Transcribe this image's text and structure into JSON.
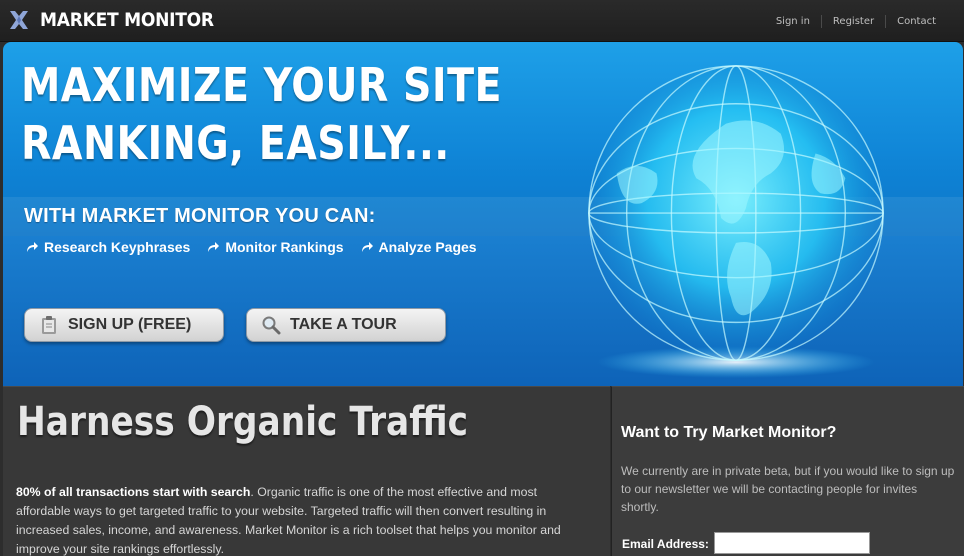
{
  "header": {
    "brand": "MARKET MONITOR",
    "nav": [
      "Sign in",
      "Register",
      "Contact"
    ]
  },
  "hero": {
    "title_line1": "MAXIMIZE YOUR SITE",
    "title_line2": "RANKING, EASILY...",
    "subtitle": "WITH MARKET MONITOR YOU CAN:",
    "features": [
      "Research Keyphrases",
      "Monitor Rankings",
      "Analyze Pages"
    ],
    "signup_label": "SIGN  UP (FREE)",
    "tour_label": "TAKE A TOUR"
  },
  "content": {
    "heading": "Harness Organic Traffic",
    "lead_bold": "80% of all transactions start with search",
    "paragraph": ". Organic traffic is one of the most effective and most affordable ways to get targeted traffic to your website. Targeted traffic will then convert resulting in increased sales, income, and awareness. Market Monitor is a rich toolset that helps you monitor and improve your site rankings effortlessly."
  },
  "sidebar": {
    "title": "Want to Try Market Monitor?",
    "text": "We currently are in private beta, but if you would like to sign up to our newsletter we will be contacting people for invites shortly.",
    "email_label": "Email Address:",
    "email_value": ""
  },
  "colors": {
    "hero_blue": "#0f84d6",
    "dark_bg": "#2d2d2d"
  }
}
